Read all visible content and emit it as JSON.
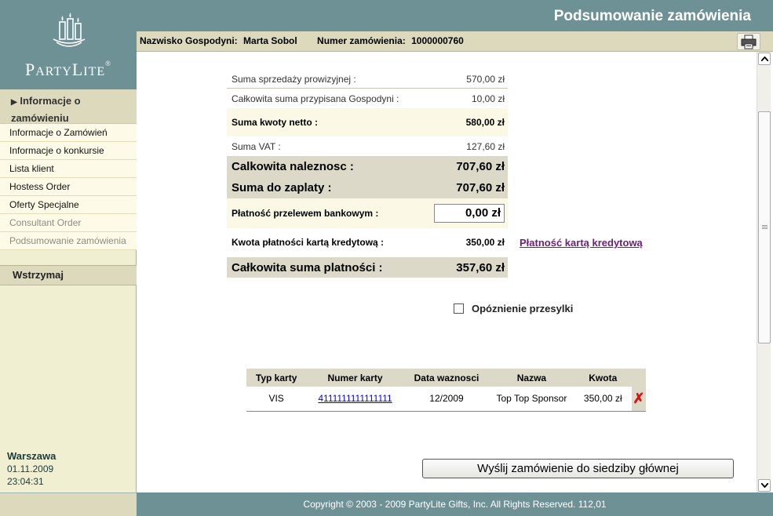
{
  "brand": {
    "name_first": "P",
    "name_rest": "ARTY",
    "name_first2": "L",
    "name_rest2": "ITE"
  },
  "header": {
    "title": "Podsumowanie zamówienia"
  },
  "infobar": {
    "host_label": "Nazwisko Gospodyni:",
    "host_value": "Marta Sobol",
    "order_label": "Numer zamówienia:",
    "order_value": "1000000760"
  },
  "sidebar": {
    "section_title": "Informacje o zamówieniu",
    "items": [
      {
        "label": "Informacje o Zamówień",
        "enabled": true
      },
      {
        "label": "Informacje o konkursie",
        "enabled": true
      },
      {
        "label": "Lista klient",
        "enabled": true
      },
      {
        "label": "Hostess Order",
        "enabled": true
      },
      {
        "label": "Oferty Specjalne",
        "enabled": true
      },
      {
        "label": "Consultant Order",
        "enabled": false
      },
      {
        "label": "Podsumowanie zamówienia",
        "enabled": false
      }
    ],
    "hold_label": "Wstrzymaj",
    "city": "Warszawa",
    "date": "01.11.2009",
    "time": "23:04:31"
  },
  "summary": {
    "commission_sales_label": "Suma sprzedaży prowizyjnej :",
    "commission_sales_value": "570,00 zł",
    "host_total_label": "Całkowita suma przypisana Gospodyni :",
    "host_total_value": "10,00 zł",
    "net_label": "Suma kwoty netto :",
    "net_value": "580,00 zł",
    "vat_label": "Suma VAT :",
    "vat_value": "127,60 zł",
    "total_due_label": "Calkowita naleznosc :",
    "total_due_value": "707,60 zł",
    "to_pay_label": "Suma do zaplaty :",
    "to_pay_value": "707,60 zł",
    "bank_label": "Płatność przelewem bankowym :",
    "bank_value": "0,00 zł",
    "card_label": "Kwota płatności kartą kredytową :",
    "card_value": "350,00 zł",
    "card_link": "Płatność kartą kredytową",
    "payments_total_label": "Całkowita suma platności :",
    "payments_total_value": "357,60 zł"
  },
  "delay_label": "Opóznienie przesylki",
  "cards_table": {
    "headers": [
      "Typ karty",
      "Numer karty",
      "Data waznosci",
      "Nazwa",
      "Kwota"
    ],
    "rows": [
      {
        "type": "VIS",
        "number": "4111111111111111",
        "expiry": "12/2009",
        "name": "Top Top Sponsor",
        "amount": "350,00  zł"
      }
    ]
  },
  "submit_label": "Wyślij zamówienie do siedziby głównej",
  "footer": "Copyright © 2003 - 2009 PartyLite Gifts, Inc. All Rights Reserved.  112,01",
  "colors": {
    "teal": "#6e9196",
    "tan": "#dcd9c8",
    "cream": "#fbf9e6",
    "link_purple": "#6b1f78",
    "delete_red": "#e01010"
  }
}
